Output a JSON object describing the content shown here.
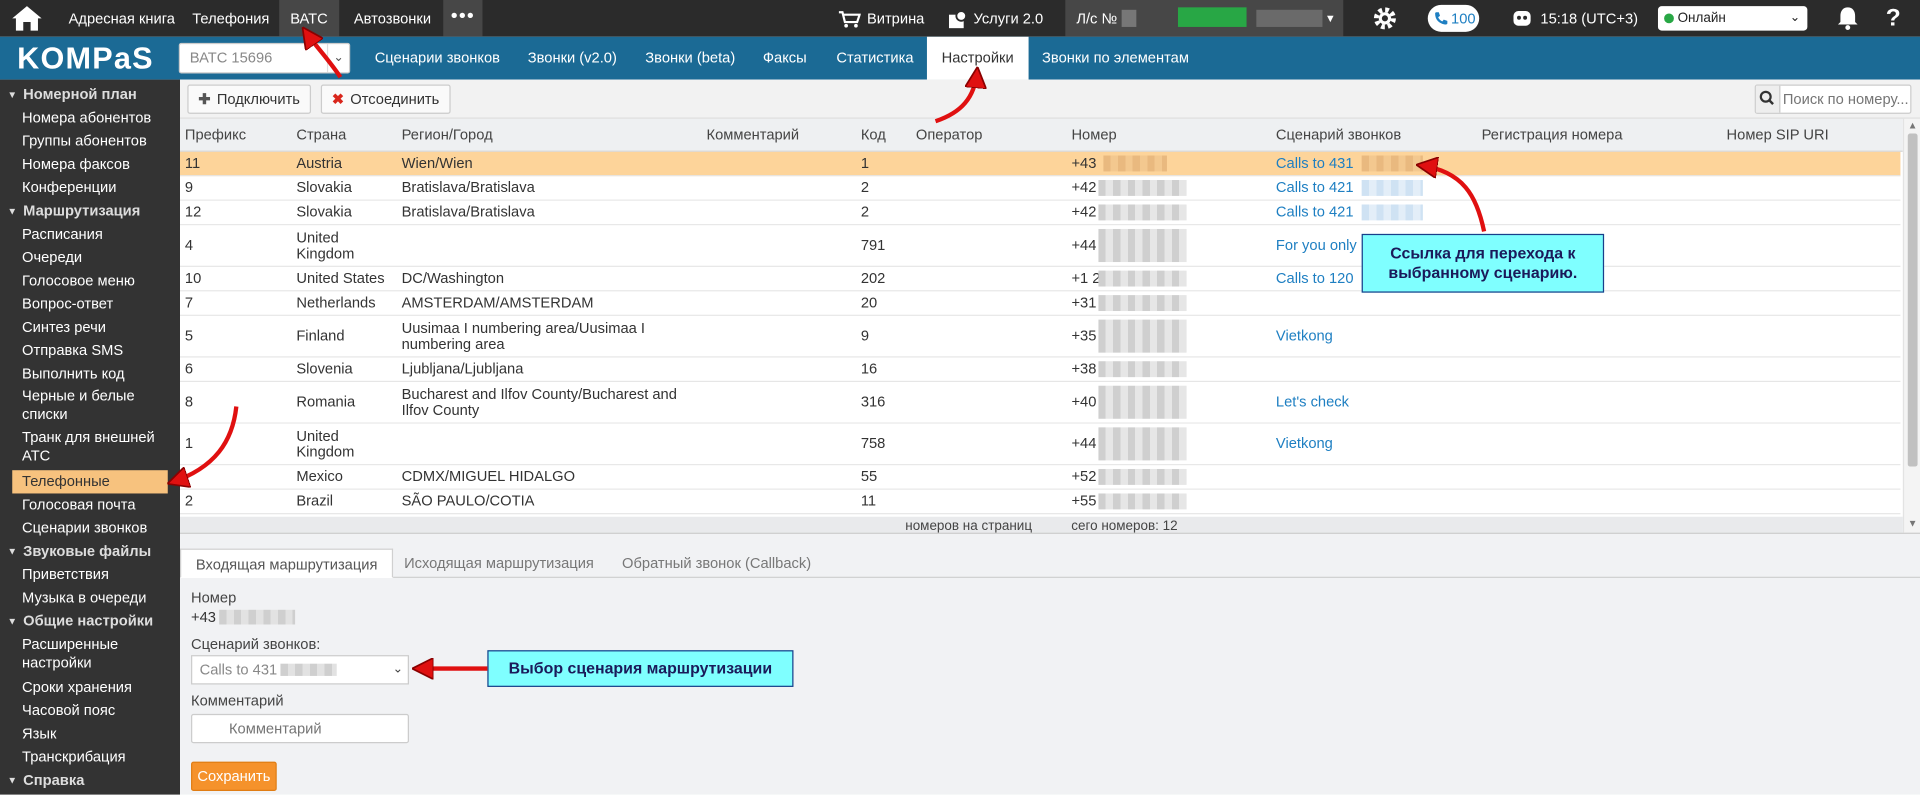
{
  "topbar": {
    "nav": [
      "Адресная книга",
      "Телефония",
      "ВАТС",
      "Автозвонки"
    ],
    "more": "•••",
    "showcase": "Витрина",
    "services": "Услуги 2.0",
    "account_label": "Л/с №",
    "balance": "100",
    "time": "15:18 (UTC+3)",
    "status": "Онлайн",
    "help": "?"
  },
  "brand": {
    "logo": "KOMPaS",
    "vats_select": "ВАТС 15696"
  },
  "subnav": [
    "Сценарии звонков",
    "Звонки (v2.0)",
    "Звонки (beta)",
    "Факсы",
    "Статистика",
    "Настройки",
    "Звонки по элементам"
  ],
  "sidebar": {
    "items": [
      {
        "label": "Номерной план",
        "group": true
      },
      {
        "label": "Номера абонентов"
      },
      {
        "label": "Группы абонентов"
      },
      {
        "label": "Номера факсов"
      },
      {
        "label": "Конференции"
      },
      {
        "label": "Маршрутизация",
        "group": true
      },
      {
        "label": "Расписания"
      },
      {
        "label": "Очереди"
      },
      {
        "label": "Голосовое меню"
      },
      {
        "label": "Вопрос-ответ"
      },
      {
        "label": "Синтез речи"
      },
      {
        "label": "Отправка SMS"
      },
      {
        "label": "Выполнить код"
      },
      {
        "label": "Черные и белые списки"
      },
      {
        "label": "Транк для внешней АТС"
      },
      {
        "label": "Телефонные номера",
        "active": true
      },
      {
        "label": "Голосовая почта"
      },
      {
        "label": "Сценарии звонков"
      },
      {
        "label": "Звуковые файлы",
        "group": true
      },
      {
        "label": "Приветствия"
      },
      {
        "label": "Музыка в очереди"
      },
      {
        "label": "Общие настройки",
        "group": true
      },
      {
        "label": "Расширенные настройки"
      },
      {
        "label": "Сроки хранения"
      },
      {
        "label": "Часовой пояс"
      },
      {
        "label": "Язык"
      },
      {
        "label": "Транскрибация"
      },
      {
        "label": "Справка",
        "group": true
      }
    ]
  },
  "toolbar": {
    "connect": "Подключить",
    "disconnect": "Отсоединить",
    "search_placeholder": "Поиск по номеру..."
  },
  "table": {
    "columns": [
      "Префикс",
      "Страна",
      "Регион/Город",
      "Комментарий",
      "Код",
      "Оператор",
      "Номер",
      "Сценарий звонков",
      "Регистрация номера",
      "Номер SIP URI"
    ],
    "rows": [
      {
        "prefix": "11",
        "country": "Austria",
        "region": "Wien/Wien",
        "code": "1",
        "number": "+43",
        "scenario": "Calls to 431",
        "selected": true
      },
      {
        "prefix": "9",
        "country": "Slovakia",
        "region": "Bratislava/Bratislava",
        "code": "2",
        "number": "+42",
        "scenario": "Calls to 421"
      },
      {
        "prefix": "12",
        "country": "Slovakia",
        "region": "Bratislava/Bratislava",
        "code": "2",
        "number": "+42",
        "scenario": "Calls to 421"
      },
      {
        "prefix": "4",
        "country": "United Kingdom",
        "region": "",
        "code": "791",
        "number": "+44",
        "scenario": "For you only"
      },
      {
        "prefix": "10",
        "country": "United States",
        "region": "DC/Washington",
        "code": "202",
        "number": "+1 2",
        "scenario": "Calls to 120"
      },
      {
        "prefix": "7",
        "country": "Netherlands",
        "region": "AMSTERDAM/AMSTERDAM",
        "code": "20",
        "number": "+31",
        "scenario": ""
      },
      {
        "prefix": "5",
        "country": "Finland",
        "region": "Uusimaa I numbering area/Uusimaa I numbering area",
        "code": "9",
        "number": "+35",
        "scenario": "Vietkong"
      },
      {
        "prefix": "6",
        "country": "Slovenia",
        "region": "Ljubljana/Ljubljana",
        "code": "16",
        "number": "+38",
        "scenario": ""
      },
      {
        "prefix": "8",
        "country": "Romania",
        "region": "Bucharest and Ilfov County/Bucharest and Ilfov County",
        "code": "316",
        "number": "+40",
        "scenario": "Let's check"
      },
      {
        "prefix": "1",
        "country": "United Kingdom",
        "region": "",
        "code": "758",
        "number": "+44",
        "scenario": "Vietkong"
      },
      {
        "prefix": "",
        "country": "Mexico",
        "region": "CDMX/MIGUEL HIDALGO",
        "code": "55",
        "number": "+52",
        "scenario": ""
      },
      {
        "prefix": "2",
        "country": "Brazil",
        "region": "SÃO PAULO/COTIA",
        "code": "11",
        "number": "+55",
        "scenario": ""
      }
    ],
    "footer_left": "номеров на страниц",
    "footer_right": "сего номеров: 12"
  },
  "detail": {
    "tabs": [
      "Входящая маршрутизация",
      "Исходящая маршрутизация",
      "Обратный звонок (Callback)"
    ],
    "number_label": "Номер",
    "number_value": "+43",
    "scenario_label": "Сценарий звонков:",
    "scenario_value": "Calls to 431",
    "comment_label": "Комментарий",
    "comment_placeholder": "Комментарий",
    "save": "Сохранить"
  },
  "annotations": {
    "callout_link": "Ссылка для перехода к выбранному сценарию.",
    "callout_select": "Выбор сценария маршрутизации",
    "colors": {
      "callout_bg": "#7fffff",
      "arrow": "#e01010"
    }
  }
}
